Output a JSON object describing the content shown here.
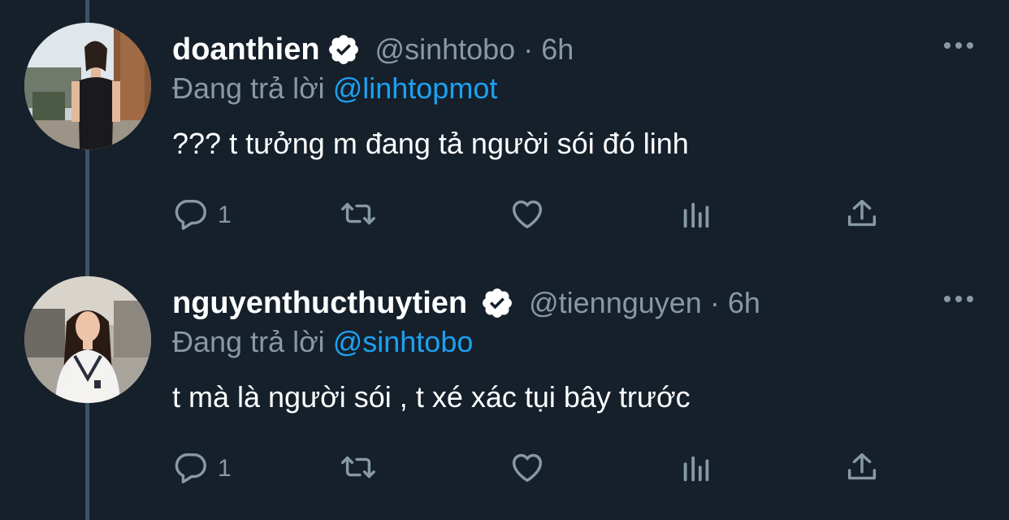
{
  "colors": {
    "background": "#15202b",
    "thread_line": "#3d5466",
    "secondary_text": "#8899a6",
    "mention_link": "#1da1f2",
    "primary_text": "#ffffff"
  },
  "icons": {
    "verified": "verified-badge-icon",
    "more": "more-dots-icon",
    "reply": "reply-icon",
    "retweet": "retweet-icon",
    "like": "like-heart-icon",
    "analytics": "analytics-bar-icon",
    "share": "share-upload-icon"
  },
  "tweets": [
    {
      "display_name": "doanthien",
      "handle": "@sinhtobo",
      "separator": "·",
      "time": "6h",
      "reply_prefix": "Đang trả lời",
      "reply_to": "@linhtopmot",
      "text": "??? t tưởng m đang tả người sói đó linh",
      "reply_count": "1"
    },
    {
      "display_name": "nguyenthucthuytien",
      "handle": "@tiennguyen",
      "separator": "·",
      "time": "6h",
      "reply_prefix": "Đang trả lời",
      "reply_to": "@sinhtobo",
      "text": "t mà là người sói , t xé xác tụi bây trước",
      "reply_count": "1"
    }
  ]
}
